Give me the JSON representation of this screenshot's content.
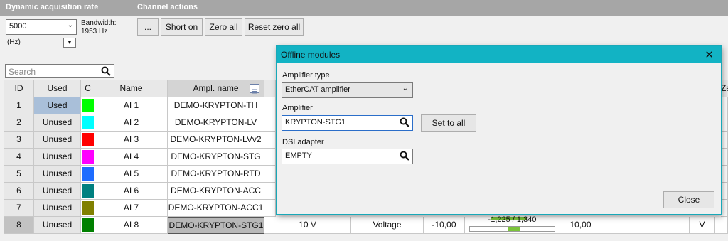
{
  "toolbar": {
    "section_rate": "Dynamic acquisition rate",
    "section_channel": "Channel actions",
    "rate_value": "5000",
    "bandwidth_label": "Bandwidth:",
    "bandwidth_value": "1953 Hz",
    "hz_label": "(Hz)",
    "more_button": "...",
    "short_on": "Short on",
    "zero_all": "Zero all",
    "reset_zero_all": "Reset zero all"
  },
  "search": {
    "placeholder": "Search"
  },
  "table": {
    "headers": {
      "id": "ID",
      "used": "Used",
      "c": "C",
      "name": "Name",
      "ampl": "Ampl. name",
      "extra": "Ze"
    },
    "rows": [
      {
        "id": "1",
        "used": "Used",
        "color": "#00ff00",
        "name": "AI 1",
        "ampl": "DEMO-KRYPTON-TH"
      },
      {
        "id": "2",
        "used": "Unused",
        "color": "#00ffff",
        "name": "AI 2",
        "ampl": "DEMO-KRYPTON-LV"
      },
      {
        "id": "3",
        "used": "Unused",
        "color": "#ff0000",
        "name": "AI 3",
        "ampl": "DEMO-KRYPTON-LVv2"
      },
      {
        "id": "4",
        "used": "Unused",
        "color": "#ff00ff",
        "name": "AI 4",
        "ampl": "DEMO-KRYPTON-STG"
      },
      {
        "id": "5",
        "used": "Unused",
        "color": "#1e6cff",
        "name": "AI 5",
        "ampl": "DEMO-KRYPTON-RTD"
      },
      {
        "id": "6",
        "used": "Unused",
        "color": "#008080",
        "name": "AI 6",
        "ampl": "DEMO-KRYPTON-ACC"
      },
      {
        "id": "7",
        "used": "Unused",
        "color": "#808000",
        "name": "AI 7",
        "ampl": "DEMO-KRYPTON-ACC1"
      },
      {
        "id": "8",
        "used": "Unused",
        "color": "#008000",
        "name": "AI 8",
        "ampl": "DEMO-KRYPTON-STG1",
        "range": "10 V",
        "measurement": "Voltage",
        "min": "-10,00",
        "value_range": "-1,225 / 1,340",
        "max": "10,00",
        "unit": "V",
        "level": 0.52
      }
    ]
  },
  "dialog": {
    "title": "Offline modules",
    "amp_type_label": "Amplifier type",
    "amp_type_value": "EtherCAT amplifier",
    "amp_label": "Amplifier",
    "amp_value": "KRYPTON-STG1",
    "set_to_all": "Set to all",
    "dsi_label": "DSI adapter",
    "dsi_value": "EMPTY",
    "close_button": "Close"
  },
  "icons": {
    "search": "search-icon",
    "chevron": "chevron-down-icon",
    "close": "close-icon",
    "column_menu": "column-menu-icon"
  },
  "colors": {
    "dialog_title": "#12b3c4",
    "used_highlight": "#a9bfd9",
    "meter_green": "#7bc43a"
  }
}
